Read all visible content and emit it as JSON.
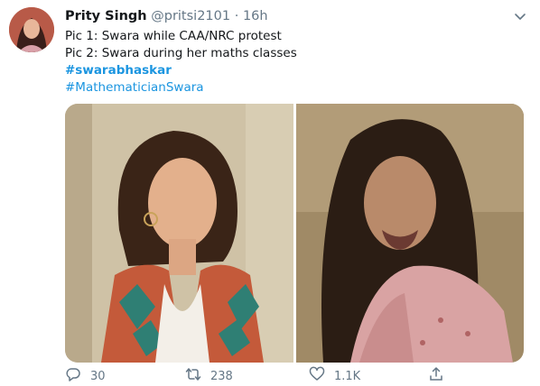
{
  "tweet": {
    "author_name": "Prity Singh",
    "author_handle": "@pritsi2101",
    "separator": "·",
    "time": "16h",
    "lines": [
      "Pic 1: Swara while CAA/NRC protest",
      "Pic 2: Swara during her maths classes"
    ],
    "hashtags": [
      "#swarabhaskar",
      "#MathematicianSwara"
    ],
    "link_color": "#1b95e0"
  },
  "actions": {
    "replies": "30",
    "retweets": "238",
    "likes": "1.1K"
  },
  "icons": [
    "chevron-down-icon",
    "reply-icon",
    "retweet-icon",
    "like-icon",
    "share-icon"
  ]
}
